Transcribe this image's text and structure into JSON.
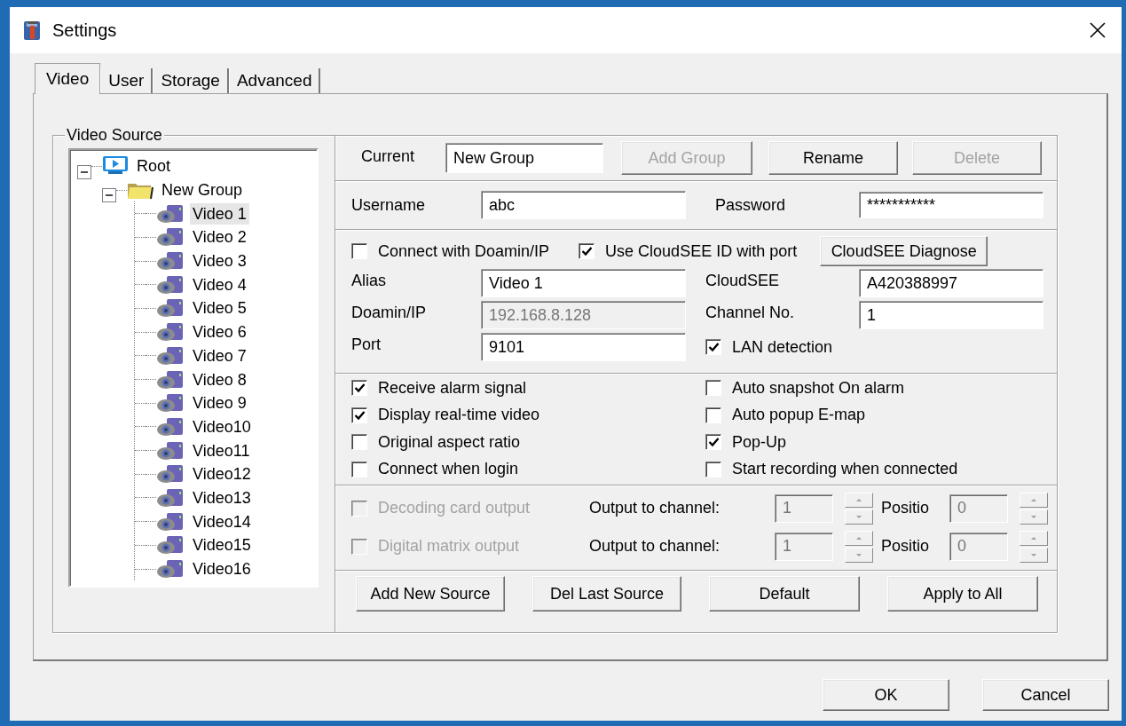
{
  "window": {
    "title": "Settings"
  },
  "tabs": [
    {
      "label": "Video",
      "selected": true
    },
    {
      "label": "User",
      "selected": false
    },
    {
      "label": "Storage",
      "selected": false
    },
    {
      "label": "Advanced",
      "selected": false
    }
  ],
  "video_source": {
    "title": "Video Source",
    "tree": [
      {
        "label": "Root",
        "kind": "root",
        "expanded": true,
        "selected": false,
        "children": [
          {
            "label": "New Group",
            "kind": "group",
            "expanded": true,
            "selected": false,
            "children": [
              {
                "label": "Video 1",
                "kind": "camera",
                "selected": true
              },
              {
                "label": "Video 2",
                "kind": "camera",
                "selected": false
              },
              {
                "label": "Video 3",
                "kind": "camera",
                "selected": false
              },
              {
                "label": "Video 4",
                "kind": "camera",
                "selected": false
              },
              {
                "label": "Video 5",
                "kind": "camera",
                "selected": false
              },
              {
                "label": "Video 6",
                "kind": "camera",
                "selected": false
              },
              {
                "label": "Video 7",
                "kind": "camera",
                "selected": false
              },
              {
                "label": "Video 8",
                "kind": "camera",
                "selected": false
              },
              {
                "label": "Video 9",
                "kind": "camera",
                "selected": false
              },
              {
                "label": "Video10",
                "kind": "camera",
                "selected": false
              },
              {
                "label": "Video11",
                "kind": "camera",
                "selected": false
              },
              {
                "label": "Video12",
                "kind": "camera",
                "selected": false
              },
              {
                "label": "Video13",
                "kind": "camera",
                "selected": false
              },
              {
                "label": "Video14",
                "kind": "camera",
                "selected": false
              },
              {
                "label": "Video15",
                "kind": "camera",
                "selected": false
              },
              {
                "label": "Video16",
                "kind": "camera",
                "selected": false
              }
            ]
          }
        ]
      }
    ]
  },
  "group": {
    "label": "Current",
    "value": "New Group",
    "buttons": [
      {
        "label": "Add Group",
        "disabled": true
      },
      {
        "label": "Rename",
        "disabled": false
      },
      {
        "label": "Delete",
        "disabled": true
      }
    ]
  },
  "login": [
    {
      "label": "Username",
      "value": "abc"
    },
    {
      "label": "Password",
      "value": "***********"
    }
  ],
  "connection": {
    "options": [
      {
        "label": "Connect with Doamin/IP",
        "checked": false
      },
      {
        "label": "Use CloudSEE ID with port",
        "checked": true
      }
    ],
    "diagnose_button": "CloudSEE Diagnose",
    "items": [
      {
        "kind": "field",
        "label": "Alias",
        "value": "Video 1",
        "disabled": false
      },
      {
        "kind": "field",
        "label": "CloudSEE",
        "value": "A420388997",
        "disabled": false
      },
      {
        "kind": "field",
        "label": "Doamin/IP",
        "value": "192.168.8.128",
        "disabled": true
      },
      {
        "kind": "field",
        "label": "Channel No.",
        "value": "1",
        "disabled": false
      },
      {
        "kind": "field",
        "label": "Port",
        "value": "9101",
        "disabled": false
      },
      {
        "kind": "checkbox",
        "label": "LAN detection",
        "checked": true
      }
    ]
  },
  "options": [
    {
      "label": "Receive alarm signal",
      "checked": true
    },
    {
      "label": "Auto snapshot On alarm",
      "checked": false
    },
    {
      "label": "Display real-time video",
      "checked": true
    },
    {
      "label": "Auto popup E-map",
      "checked": false
    },
    {
      "label": "Original aspect ratio",
      "checked": false
    },
    {
      "label": "Pop-Up",
      "checked": true
    },
    {
      "label": "Connect when login",
      "checked": false
    },
    {
      "label": "Start recording when connected",
      "checked": false
    }
  ],
  "outputs": [
    {
      "label": "Decoding card output",
      "checked": false,
      "disabled": true,
      "channel_label": "Output to channel:",
      "channel_value": "1",
      "position_label": "Positio",
      "position_value": "0"
    },
    {
      "label": "Digital matrix output",
      "checked": false,
      "disabled": true,
      "channel_label": "Output to channel:",
      "channel_value": "1",
      "position_label": "Positio",
      "position_value": "0"
    }
  ],
  "source_buttons": [
    "Add New Source",
    "Del Last Source",
    "Default",
    "Apply to All"
  ],
  "dialog_buttons": [
    "OK",
    "Cancel"
  ]
}
